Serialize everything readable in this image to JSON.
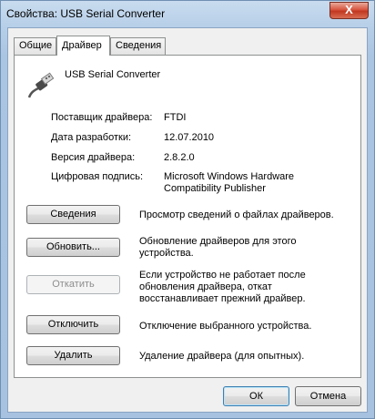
{
  "window": {
    "title": "Свойства: USB Serial Converter",
    "close_label": "X"
  },
  "tabs": [
    {
      "label": "Общие"
    },
    {
      "label": "Драйвер"
    },
    {
      "label": "Сведения"
    }
  ],
  "active_tab": "Драйвер",
  "device": {
    "name": "USB Serial Converter",
    "icon": "usb-plug-icon"
  },
  "driver_info": [
    {
      "label": "Поставщик драйвера:",
      "value": "FTDI"
    },
    {
      "label": "Дата разработки:",
      "value": "12.07.2010"
    },
    {
      "label": "Версия драйвера:",
      "value": "2.8.2.0"
    },
    {
      "label": "Цифровая подпись:",
      "value": "Microsoft Windows Hardware Compatibility Publisher"
    }
  ],
  "actions": [
    {
      "label": "Сведения",
      "description": "Просмотр сведений о файлах драйверов.",
      "enabled": true
    },
    {
      "label": "Обновить...",
      "description": "Обновление драйверов для этого устройства.",
      "enabled": true
    },
    {
      "label": "Откатить",
      "description": "Если устройство не работает после обновления драйвера, откат восстанавливает прежний драйвер.",
      "enabled": false
    },
    {
      "label": "Отключить",
      "description": "Отключение выбранного устройства.",
      "enabled": true
    },
    {
      "label": "Удалить",
      "description": "Удаление драйвера (для опытных).",
      "enabled": true
    }
  ],
  "footer": {
    "ok_label": "ОК",
    "cancel_label": "Отмена"
  }
}
